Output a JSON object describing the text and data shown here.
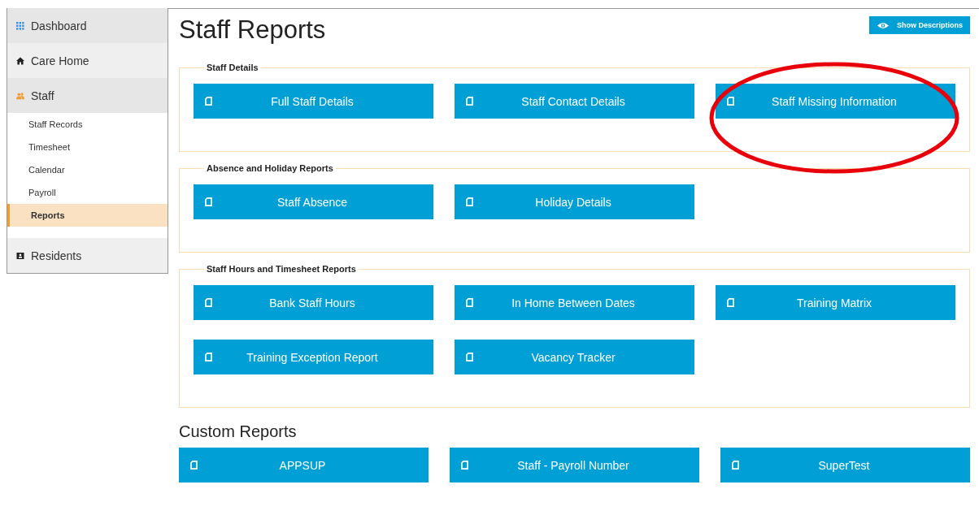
{
  "sidebar": {
    "items": [
      {
        "label": "Dashboard",
        "selected": false
      },
      {
        "label": "Care Home",
        "selected": false
      },
      {
        "label": "Staff",
        "selected": false,
        "expanded": true,
        "children": [
          {
            "label": "Staff Records",
            "selected": false
          },
          {
            "label": "Timesheet",
            "selected": false
          },
          {
            "label": "Calendar",
            "selected": false
          },
          {
            "label": "Payroll",
            "selected": false
          },
          {
            "label": "Reports",
            "selected": true
          }
        ]
      },
      {
        "label": "Residents",
        "selected": false
      }
    ]
  },
  "page": {
    "title": "Staff Reports",
    "show_descriptions": "Show Descriptions"
  },
  "sections": [
    {
      "legend": "Staff Details",
      "reports": [
        "Full Staff Details",
        "Staff Contact Details",
        "Staff Missing Information"
      ]
    },
    {
      "legend": "Absence and Holiday Reports",
      "reports": [
        "Staff Absence",
        "Holiday Details"
      ]
    },
    {
      "legend": "Staff Hours and Timesheet Reports",
      "reports": [
        "Bank Staff Hours",
        "In Home Between Dates",
        "Training Matrix",
        "Training Exception Report",
        "Vacancy Tracker"
      ]
    }
  ],
  "custom_reports": {
    "title": "Custom Reports",
    "reports": [
      "APPSUP",
      "Staff - Payroll Number",
      "SuperTest"
    ]
  }
}
